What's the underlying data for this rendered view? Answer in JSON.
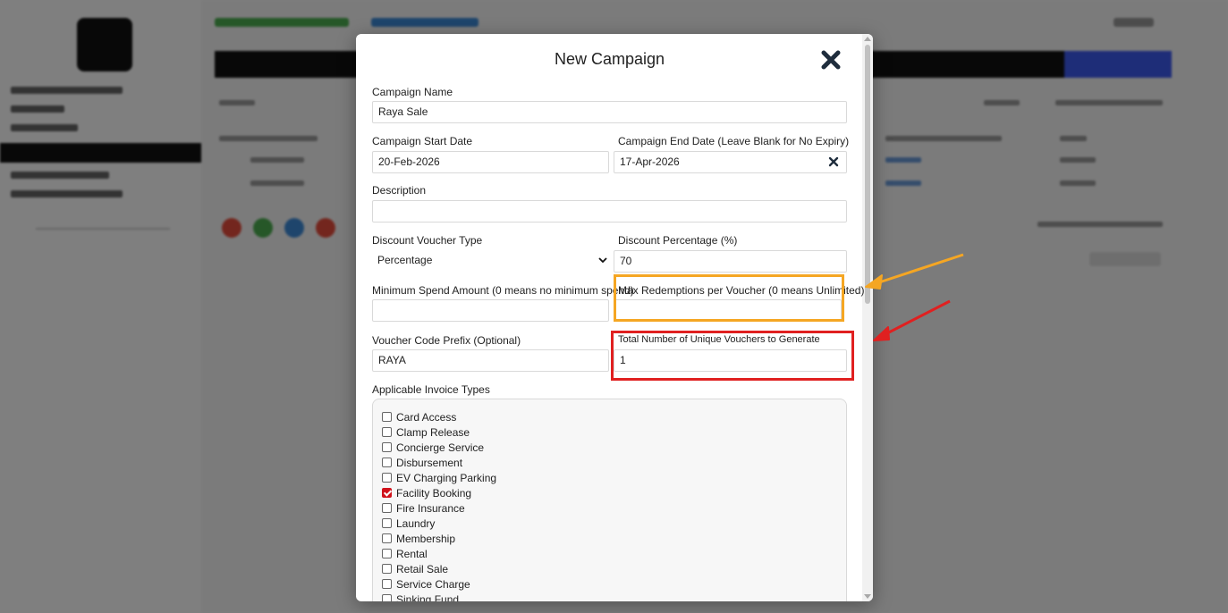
{
  "modal": {
    "title": "New Campaign",
    "close_icon": "close-icon"
  },
  "form": {
    "campaign_name": {
      "label": "Campaign Name",
      "value": "Raya Sale"
    },
    "start_date": {
      "label": "Campaign Start Date",
      "value": "20-Feb-2026"
    },
    "end_date": {
      "label": "Campaign End Date (Leave Blank for No Expiry)",
      "value": "17-Apr-2026"
    },
    "description": {
      "label": "Description",
      "value": ""
    },
    "voucher_type": {
      "label": "Discount Voucher Type",
      "value": "Percentage"
    },
    "discount_percentage": {
      "label": "Discount Percentage (%)",
      "value": "70"
    },
    "min_spend": {
      "label": "Minimum Spend Amount (0 means no minimum spend)",
      "value": ""
    },
    "max_redemptions": {
      "label": "Max Redemptions per Voucher (0 means Unlimited)",
      "value": ""
    },
    "code_prefix": {
      "label": "Voucher Code Prefix (Optional)",
      "value": "RAYA"
    },
    "total_vouchers": {
      "label": "Total Number of Unique Vouchers to Generate",
      "value": "1"
    },
    "invoice_types": {
      "label": "Applicable Invoice Types",
      "items": [
        {
          "label": "Card Access",
          "checked": false
        },
        {
          "label": "Clamp Release",
          "checked": false
        },
        {
          "label": "Concierge Service",
          "checked": false
        },
        {
          "label": "Disbursement",
          "checked": false
        },
        {
          "label": "EV Charging Parking",
          "checked": false
        },
        {
          "label": "Facility Booking",
          "checked": true
        },
        {
          "label": "Fire Insurance",
          "checked": false
        },
        {
          "label": "Laundry",
          "checked": false
        },
        {
          "label": "Membership",
          "checked": false
        },
        {
          "label": "Rental",
          "checked": false
        },
        {
          "label": "Retail Sale",
          "checked": false
        },
        {
          "label": "Service Charge",
          "checked": false
        },
        {
          "label": "Sinking Fund",
          "checked": false
        }
      ]
    }
  },
  "annotations": {
    "orange_color": "#f5a623",
    "red_color": "#e02020"
  }
}
